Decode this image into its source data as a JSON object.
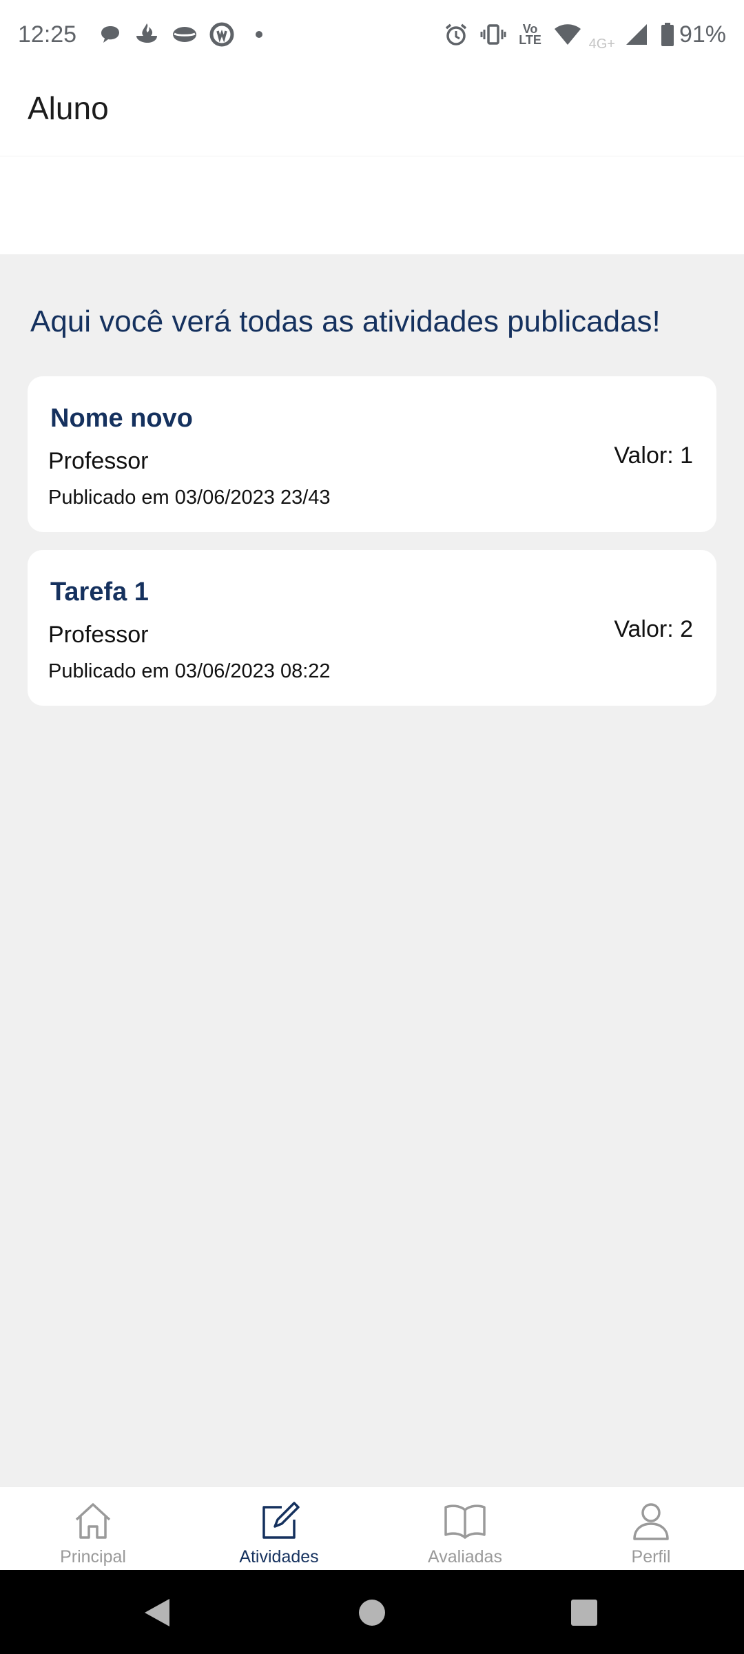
{
  "status_bar": {
    "time": "12:25",
    "network_label": "4G+",
    "volte_label_top": "Vo",
    "volte_label_bottom": "LTE",
    "battery": "91%",
    "icons": [
      "chat-bubble-icon",
      "santander-icon",
      "lips-icon",
      "at-sign-icon",
      "dot-icon",
      "alarm-icon",
      "vibrate-icon",
      "volte-icon",
      "wifi-icon",
      "signal-icon",
      "battery-icon"
    ]
  },
  "app_bar": {
    "title": "Aluno"
  },
  "main": {
    "headline": "Aqui você verá todas as atividades publicadas!",
    "activities": [
      {
        "title": "Nome novo",
        "author": "Professor",
        "published": "Publicado em 03/06/2023 23/43",
        "value": "Valor: 1"
      },
      {
        "title": "Tarefa 1",
        "author": "Professor",
        "published": "Publicado em 03/06/2023 08:22",
        "value": "Valor: 2"
      }
    ]
  },
  "bottom_nav": {
    "items": [
      {
        "label": "Principal",
        "icon": "home-icon",
        "active": false
      },
      {
        "label": "Atividades",
        "icon": "edit-icon",
        "active": true
      },
      {
        "label": "Avaliadas",
        "icon": "book-icon",
        "active": false
      },
      {
        "label": "Perfil",
        "icon": "person-icon",
        "active": false
      }
    ]
  },
  "colors": {
    "primary": "#15315e",
    "background": "#f0f0f0",
    "card": "#ffffff",
    "inactive": "#9a9a9a"
  }
}
